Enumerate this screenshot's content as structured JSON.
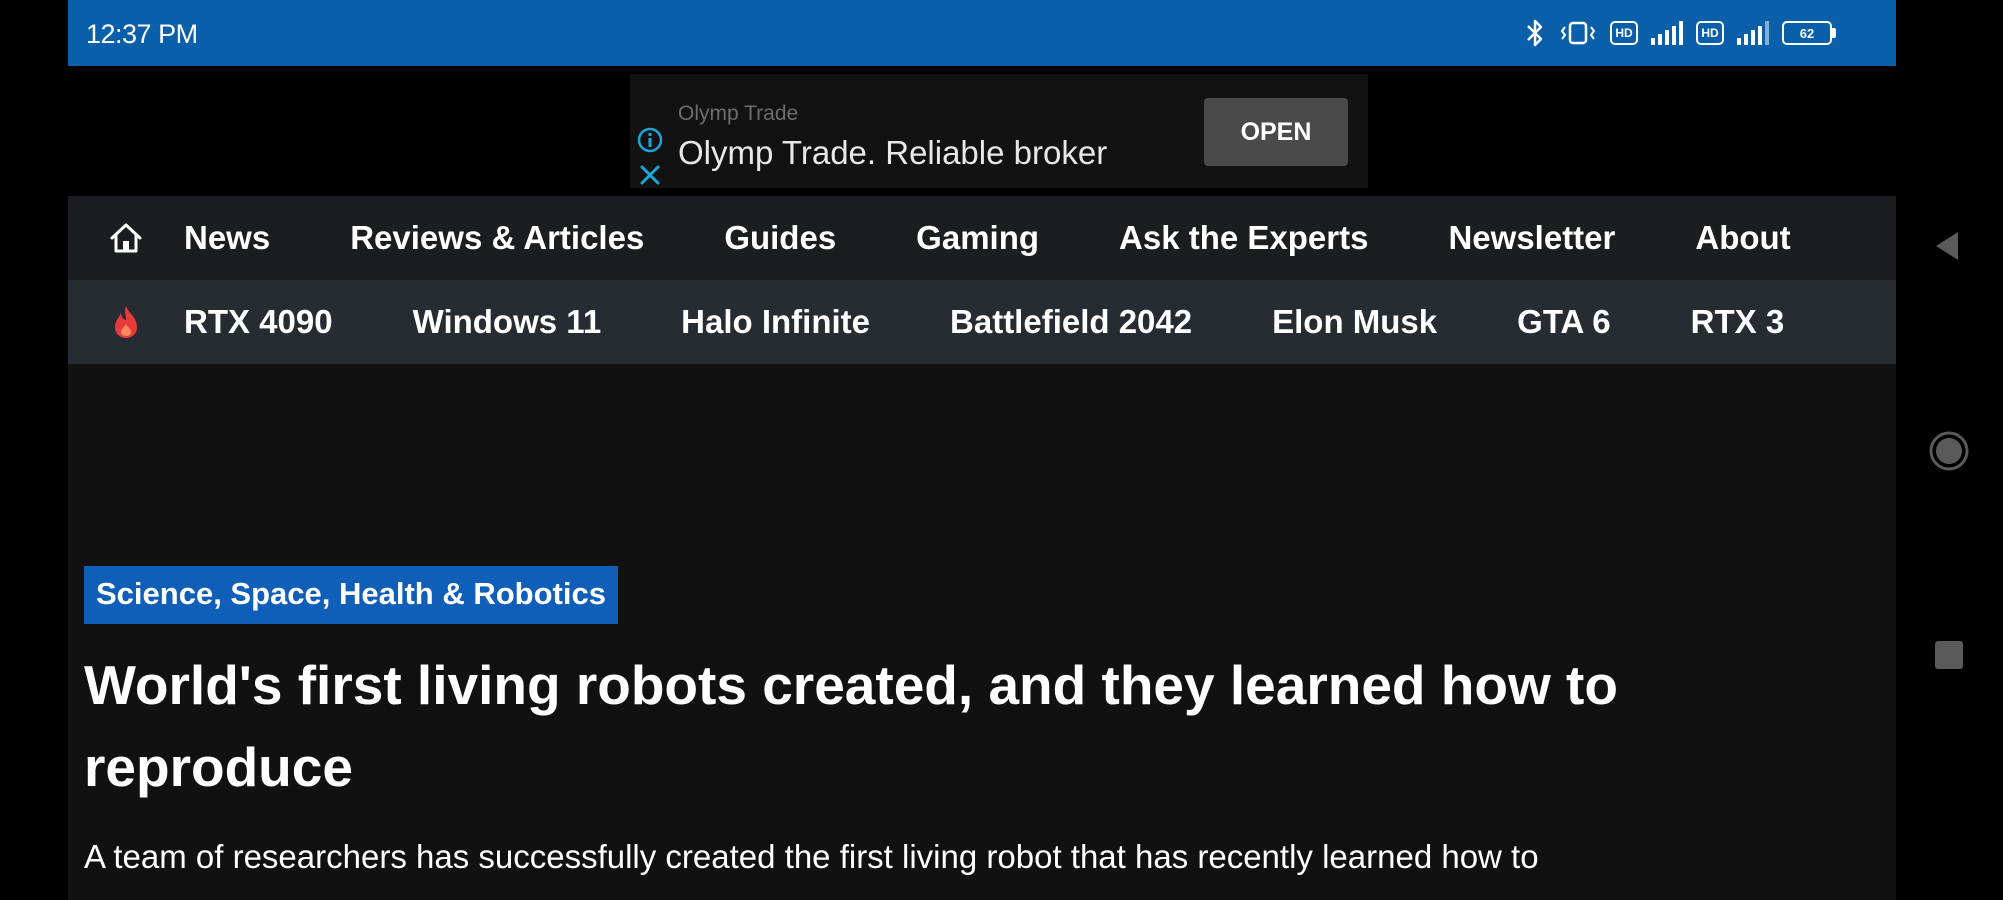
{
  "status_bar": {
    "time": "12:37 PM",
    "battery": "62",
    "network_tags": [
      "HD",
      "HD"
    ],
    "icons": [
      "bluetooth-icon",
      "vibrate-icon",
      "hd-icon",
      "signal-icon",
      "hd-icon",
      "signal-icon",
      "battery-icon"
    ],
    "bg_color": "#0a5faa"
  },
  "ad": {
    "sponsor": "Olymp Trade",
    "headline": "Olymp Trade. Reliable broker",
    "open_label": "OPEN",
    "icons": [
      "info-icon",
      "close-icon"
    ]
  },
  "primary_nav": {
    "home_icon": "home-icon",
    "items": [
      {
        "label": "News"
      },
      {
        "label": "Reviews & Articles"
      },
      {
        "label": "Guides"
      },
      {
        "label": "Gaming"
      },
      {
        "label": "Ask the Experts"
      },
      {
        "label": "Newsletter"
      },
      {
        "label": "About"
      }
    ]
  },
  "trending_nav": {
    "trending_icon": "fire-icon",
    "items": [
      {
        "label": "RTX 4090"
      },
      {
        "label": "Windows 11"
      },
      {
        "label": "Halo Infinite"
      },
      {
        "label": "Battlefield 2042"
      },
      {
        "label": "Elon Musk"
      },
      {
        "label": "GTA 6"
      },
      {
        "label": "RTX 3"
      }
    ]
  },
  "article": {
    "category": "Science, Space, Health & Robotics",
    "title": "World's first living robots created, and they learned how to reproduce",
    "summary": "A team of researchers has successfully created the first living robot that has recently learned how to",
    "category_color": "#0f5fb8",
    "fire_color": "#e53b3b"
  },
  "android_nav": {
    "icons": [
      "back-icon",
      "home-circle-icon",
      "recents-icon"
    ]
  }
}
